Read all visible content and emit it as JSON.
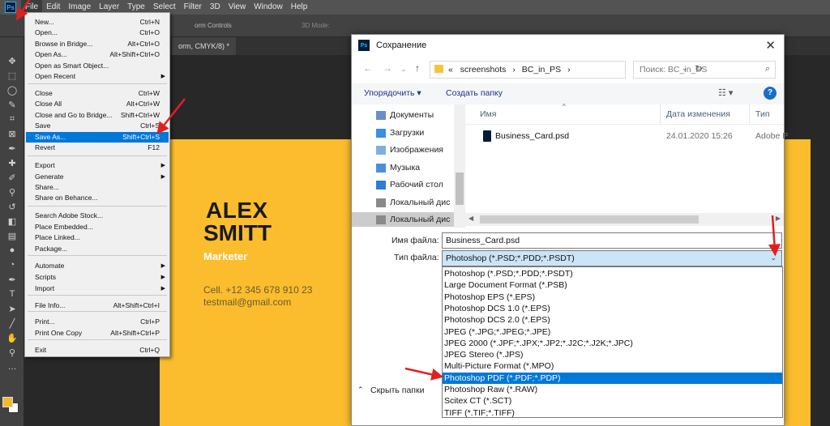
{
  "app": {
    "menubar": [
      "File",
      "Edit",
      "Image",
      "Layer",
      "Type",
      "Select",
      "Filter",
      "3D",
      "View",
      "Window",
      "Help"
    ],
    "options_text": "orm Controls",
    "mode_3d": "3D Mode:",
    "doc_tab": "orm, CMYK/8) *"
  },
  "file_menu": [
    {
      "label": "New...",
      "shortcut": "Ctrl+N"
    },
    {
      "label": "Open...",
      "shortcut": "Ctrl+O"
    },
    {
      "label": "Browse in Bridge...",
      "shortcut": "Alt+Ctrl+O"
    },
    {
      "label": "Open As...",
      "shortcut": "Alt+Shift+Ctrl+O"
    },
    {
      "label": "Open as Smart Object...",
      "shortcut": ""
    },
    {
      "label": "Open Recent",
      "shortcut": "",
      "submenu": true
    },
    {
      "label": "Close",
      "shortcut": "Ctrl+W"
    },
    {
      "label": "Close All",
      "shortcut": "Alt+Ctrl+W"
    },
    {
      "label": "Close and Go to Bridge...",
      "shortcut": "Shift+Ctrl+W"
    },
    {
      "label": "Save",
      "shortcut": "Ctrl+S"
    },
    {
      "label": "Save As...",
      "shortcut": "Shift+Ctrl+S",
      "highlighted": true
    },
    {
      "label": "Revert",
      "shortcut": "F12"
    },
    {
      "label": "Export",
      "shortcut": "",
      "submenu": true
    },
    {
      "label": "Generate",
      "shortcut": "",
      "submenu": true
    },
    {
      "label": "Share...",
      "shortcut": ""
    },
    {
      "label": "Share on Behance...",
      "shortcut": ""
    },
    {
      "label": "Search Adobe Stock...",
      "shortcut": ""
    },
    {
      "label": "Place Embedded...",
      "shortcut": ""
    },
    {
      "label": "Place Linked...",
      "shortcut": ""
    },
    {
      "label": "Package...",
      "shortcut": ""
    },
    {
      "label": "Automate",
      "shortcut": "",
      "submenu": true
    },
    {
      "label": "Scripts",
      "shortcut": "",
      "submenu": true
    },
    {
      "label": "Import",
      "shortcut": "",
      "submenu": true
    },
    {
      "label": "File Info...",
      "shortcut": "Alt+Shift+Ctrl+I"
    },
    {
      "label": "Print...",
      "shortcut": "Ctrl+P"
    },
    {
      "label": "Print One Copy",
      "shortcut": "Alt+Shift+Ctrl+P"
    },
    {
      "label": "Exit",
      "shortcut": "Ctrl+Q"
    }
  ],
  "card": {
    "name_first": "ALEX",
    "name_last": "SMITT",
    "role": "Marketer",
    "phone": "Cell. +12 345 678 910 23",
    "email": "testmail@gmail.com"
  },
  "dialog": {
    "title": "Сохранение",
    "close": "✕",
    "path_prefix": "«",
    "path": [
      "screenshots",
      "BC_in_PS"
    ],
    "search_placeholder": "Поиск: BC_in_PS",
    "organize": "Упорядочить ▾",
    "new_folder": "Создать папку",
    "help": "?",
    "nav_items": [
      "Документы",
      "Загрузки",
      "Изображения",
      "Музыка",
      "Рабочий стол",
      "Локальный дис",
      "Локальный дис"
    ],
    "columns": [
      "Имя",
      "Дата изменения",
      "Тип"
    ],
    "file": {
      "name": "Business_Card.psd",
      "date": "24.01.2020 15:26",
      "type": "Adobe P"
    },
    "filename_label": "Имя файла:",
    "filename_value": "Business_Card.psd",
    "filetype_label": "Тип файла:",
    "filetype_value": "Photoshop (*.PSD;*.PDD;*.PSDT)",
    "filetype_options": [
      "Photoshop (*.PSD;*.PDD;*.PSDT)",
      "Large Document Format (*.PSB)",
      "Photoshop EPS (*.EPS)",
      "Photoshop DCS 1.0 (*.EPS)",
      "Photoshop DCS 2.0 (*.EPS)",
      "JPEG (*.JPG;*.JPEG;*.JPE)",
      "JPEG 2000 (*.JPF;*.JPX;*.JP2;*.J2C;*.J2K;*.JPC)",
      "JPEG Stereo (*.JPS)",
      "Multi-Picture Format (*.MPO)",
      "Photoshop PDF (*.PDF;*.PDP)",
      "Photoshop Raw (*.RAW)",
      "Scitex CT (*.SCT)",
      "TIFF (*.TIF;*.TIFF)"
    ],
    "highlighted_option": "Photoshop PDF (*.PDF;*.PDP)",
    "hide_folders": "Скрыть папки"
  },
  "colors": {
    "card_yellow": "#fbbd2d",
    "highlight_blue": "#0078d7",
    "annotation_red": "#e02020"
  }
}
